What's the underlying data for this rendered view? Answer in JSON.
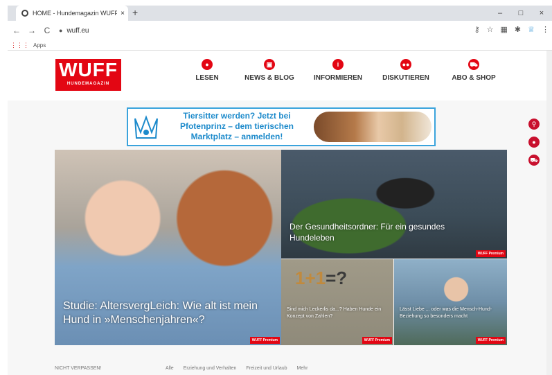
{
  "browser": {
    "tab_title": "HOME - Hundemagazin WUFF",
    "tab_close": "×",
    "new_tab": "+",
    "win_min": "–",
    "win_max": "□",
    "win_close": "×",
    "back": "←",
    "forward": "→",
    "reload": "C",
    "url": "wuff.eu",
    "bookmarks_label": "Apps",
    "icons": [
      "key-icon",
      "star-icon",
      "extension-icon",
      "puzzle-icon",
      "ext-icon",
      "menu-icon"
    ]
  },
  "site": {
    "logo_big": "WUFF",
    "logo_small": "HUNDEMAGAZIN",
    "menu": [
      {
        "label": "LESEN",
        "icon": "reader-icon"
      },
      {
        "label": "NEWS & BLOG",
        "icon": "news-icon"
      },
      {
        "label": "INFORMIEREN",
        "icon": "info-icon"
      },
      {
        "label": "DISKUTIEREN",
        "icon": "chat-icon"
      },
      {
        "label": "ABO & SHOP",
        "icon": "cart-icon"
      }
    ],
    "banner_text": "Tiersitter werden? Jetzt bei Pfotenprinz – dem tierischen Marktplatz – anmelden!",
    "brand_color": "#e30613",
    "banner_color": "#1c8acb"
  },
  "tiles": [
    {
      "caption": "Studie: AltersvergLeich: Wie alt ist mein Hund in »Menschenjahren«?",
      "badge": "WUFF Premium"
    },
    {
      "caption": "Der Gesundheitsordner: Für ein gesundes Hundeleben",
      "badge": "WUFF Premium"
    },
    {
      "caption": "Sind mich Leckerlis da...? Haben Hunde ein Konzept von Zahlen?",
      "badge": "WUFF Premium"
    },
    {
      "caption": "Lässt Liebe ... oder was die Mensch-Hund-Beziehung so besonders macht",
      "badge": "WUFF Premium"
    }
  ],
  "footer": {
    "nicht": "NICHT VERPASSEN!",
    "filters": [
      "Alle",
      "Erziehung und Verhalten",
      "Freizeit und Urlaub",
      "Mehr"
    ]
  }
}
